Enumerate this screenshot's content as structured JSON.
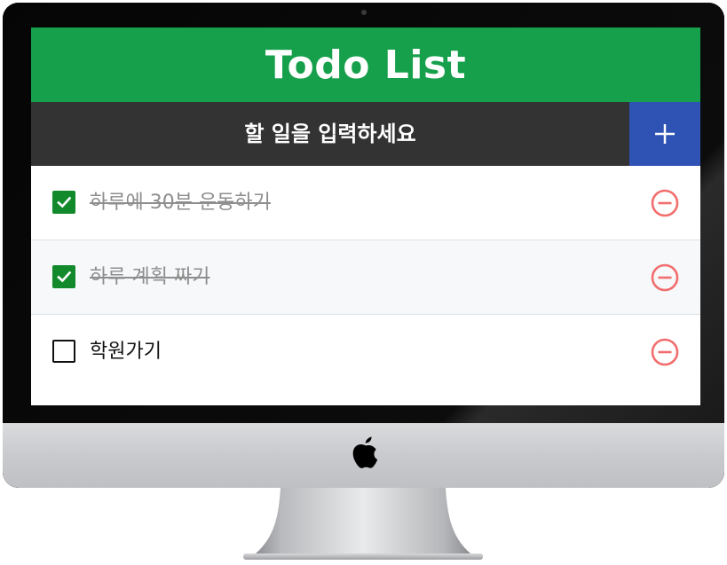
{
  "app": {
    "title": "Todo List",
    "input_placeholder": "할 일을 입력하세요",
    "add_label": "+"
  },
  "todos": [
    {
      "text": "하루에 30분 운동하기",
      "done": true
    },
    {
      "text": "하루 계획 짜기",
      "done": true
    },
    {
      "text": "학원가기",
      "done": false
    }
  ],
  "colors": {
    "header_bg": "#16a04b",
    "input_bar_bg": "#333333",
    "add_button_bg": "#2f53b5",
    "checkbox_checked": "#128a2c",
    "remove_icon": "#f26d6d",
    "done_text": "#8e8e8e"
  },
  "icons": {
    "checkbox_checked": "checkbox-checked-icon",
    "checkbox_unchecked": "checkbox-unchecked-icon",
    "remove": "minus-circle-icon",
    "brand": "apple-logo"
  }
}
